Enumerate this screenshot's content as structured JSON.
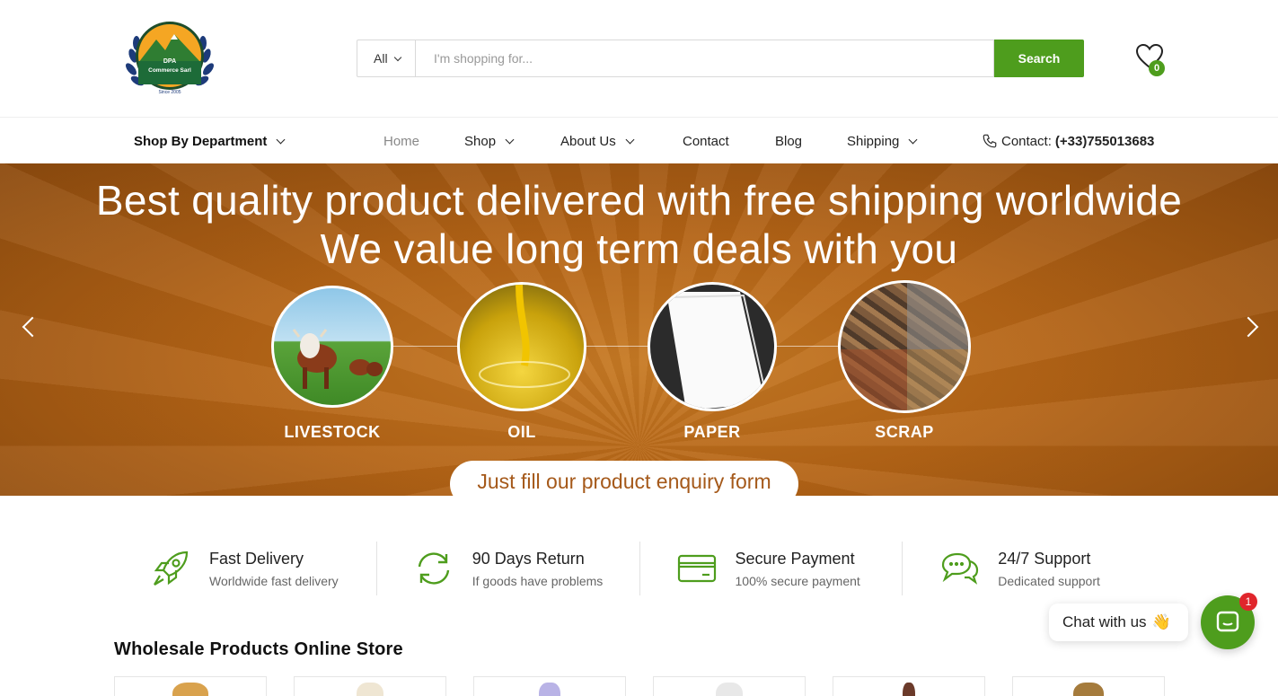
{
  "brand": {
    "logo_text_top": "DPA",
    "logo_text_main": "Commerce Sarl",
    "logo_text_since": "Since 2005"
  },
  "search": {
    "category_value": "All",
    "placeholder": "I'm shopping for...",
    "button_label": "Search"
  },
  "wishlist": {
    "count": "0"
  },
  "nav": {
    "department_label": "Shop By Department",
    "items": [
      {
        "label": "Home",
        "has_dropdown": false,
        "active": true
      },
      {
        "label": "Shop",
        "has_dropdown": true
      },
      {
        "label": "About Us",
        "has_dropdown": true
      },
      {
        "label": "Contact",
        "has_dropdown": false
      },
      {
        "label": "Blog",
        "has_dropdown": false
      },
      {
        "label": "Shipping",
        "has_dropdown": true
      }
    ],
    "contact_label": "Contact:",
    "contact_phone": "(+33)755013683"
  },
  "banner": {
    "headline_1": "Best quality product delivered with free shipping worldwide",
    "headline_2": "We value long term deals with you",
    "categories": [
      "LIVESTOCK",
      "OIL",
      "PAPER",
      "SCRAP"
    ],
    "cta": "Just fill our product enquiry form"
  },
  "features": [
    {
      "icon": "rocket-icon",
      "title": "Fast Delivery",
      "subtitle": "Worldwide fast delivery"
    },
    {
      "icon": "refresh-icon",
      "title": "90 Days Return",
      "subtitle": "If goods have problems"
    },
    {
      "icon": "credit-card-icon",
      "title": "Secure Payment",
      "subtitle": "100% secure payment"
    },
    {
      "icon": "chat-bubbles-icon",
      "title": "24/7 Support",
      "subtitle": "Dedicated support"
    }
  ],
  "section": {
    "title": "Wholesale Products Online Store"
  },
  "chat": {
    "label": "Chat with us",
    "wave": "👋",
    "badge_count": "1"
  },
  "colors": {
    "accent": "#4e9d1d",
    "banner": "#b46416",
    "badge": "#e0262c"
  }
}
